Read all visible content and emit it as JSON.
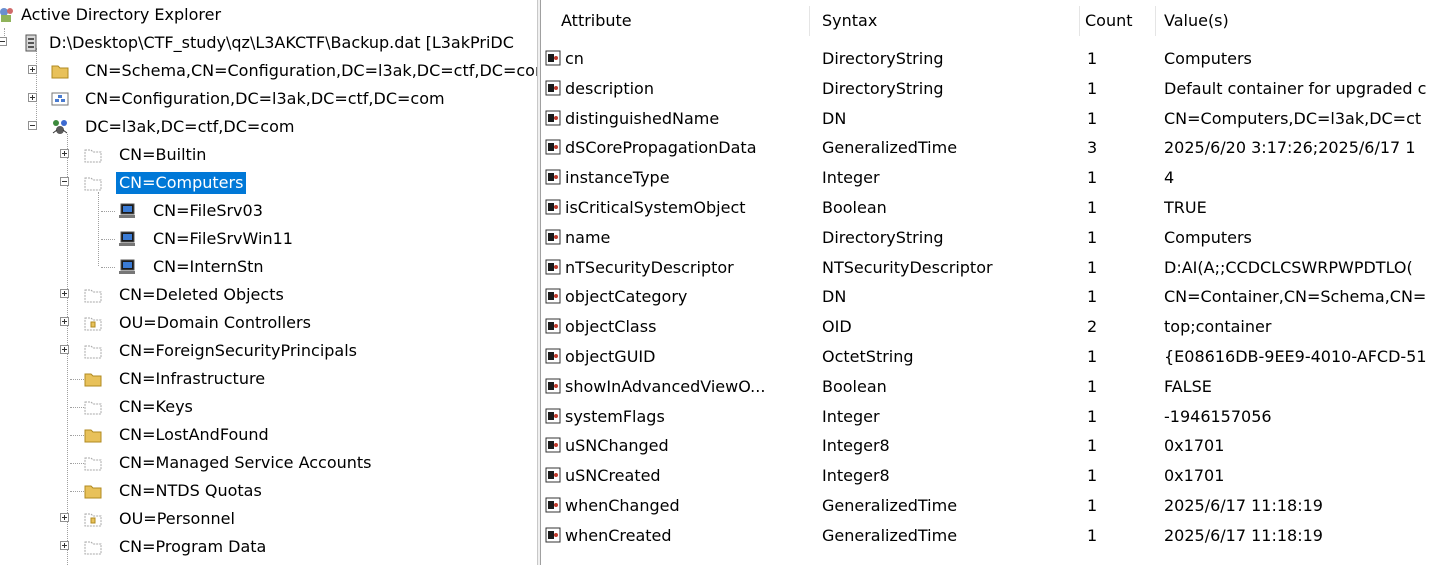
{
  "tree": {
    "root_label": "Active Directory Explorer",
    "snapshot_label": "D:\\Desktop\\CTF_study\\qz\\L3AKCTF\\Backup.dat [L3akPriDC",
    "nodes": [
      {
        "label": "CN=Schema,CN=Configuration,DC=l3ak,DC=ctf,DC=com",
        "icon": "folder-icon"
      },
      {
        "label": "CN=Configuration,DC=l3ak,DC=ctf,DC=com",
        "icon": "configuration-icon"
      },
      {
        "label": "DC=l3ak,DC=ctf,DC=com",
        "icon": "domain-icon"
      },
      {
        "label": "CN=Builtin",
        "icon": "container-icon"
      },
      {
        "label": "CN=Computers",
        "icon": "container-icon"
      },
      {
        "label": "CN=FileSrv03",
        "icon": "computer-icon"
      },
      {
        "label": "CN=FileSrvWin11",
        "icon": "computer-icon"
      },
      {
        "label": "CN=InternStn",
        "icon": "computer-icon"
      },
      {
        "label": "CN=Deleted Objects",
        "icon": "container-icon"
      },
      {
        "label": "OU=Domain Controllers",
        "icon": "ou-icon"
      },
      {
        "label": "CN=ForeignSecurityPrincipals",
        "icon": "container-icon"
      },
      {
        "label": "CN=Infrastructure",
        "icon": "folder-icon"
      },
      {
        "label": "CN=Keys",
        "icon": "container-icon"
      },
      {
        "label": "CN=LostAndFound",
        "icon": "folder-icon"
      },
      {
        "label": "CN=Managed Service Accounts",
        "icon": "container-icon"
      },
      {
        "label": "CN=NTDS Quotas",
        "icon": "folder-icon"
      },
      {
        "label": "OU=Personnel",
        "icon": "ou-icon"
      },
      {
        "label": "CN=Program Data",
        "icon": "container-icon"
      }
    ]
  },
  "attributes": {
    "columns": [
      "Attribute",
      "Syntax",
      "Count",
      "Value(s)"
    ],
    "rows": [
      {
        "attribute": "cn",
        "syntax": "DirectoryString",
        "count": "1",
        "value": "Computers"
      },
      {
        "attribute": "description",
        "syntax": "DirectoryString",
        "count": "1",
        "value": "Default container for upgraded c"
      },
      {
        "attribute": "distinguishedName",
        "syntax": "DN",
        "count": "1",
        "value": "CN=Computers,DC=l3ak,DC=ct"
      },
      {
        "attribute": "dSCorePropagationData",
        "syntax": "GeneralizedTime",
        "count": "3",
        "value": "2025/6/20 3:17:26;2025/6/17 1"
      },
      {
        "attribute": "instanceType",
        "syntax": "Integer",
        "count": "1",
        "value": "4"
      },
      {
        "attribute": "isCriticalSystemObject",
        "syntax": "Boolean",
        "count": "1",
        "value": "TRUE"
      },
      {
        "attribute": "name",
        "syntax": "DirectoryString",
        "count": "1",
        "value": "Computers"
      },
      {
        "attribute": "nTSecurityDescriptor",
        "syntax": "NTSecurityDescriptor",
        "count": "1",
        "value": "D:AI(A;;CCDCLCSWRPWPDTLO("
      },
      {
        "attribute": "objectCategory",
        "syntax": "DN",
        "count": "1",
        "value": "CN=Container,CN=Schema,CN="
      },
      {
        "attribute": "objectClass",
        "syntax": "OID",
        "count": "2",
        "value": "top;container"
      },
      {
        "attribute": "objectGUID",
        "syntax": "OctetString",
        "count": "1",
        "value": "{E08616DB-9EE9-4010-AFCD-51"
      },
      {
        "attribute": "showInAdvancedViewO...",
        "syntax": "Boolean",
        "count": "1",
        "value": "FALSE"
      },
      {
        "attribute": "systemFlags",
        "syntax": "Integer",
        "count": "1",
        "value": "-1946157056"
      },
      {
        "attribute": "uSNChanged",
        "syntax": "Integer8",
        "count": "1",
        "value": "0x1701"
      },
      {
        "attribute": "uSNCreated",
        "syntax": "Integer8",
        "count": "1",
        "value": "0x1701"
      },
      {
        "attribute": "whenChanged",
        "syntax": "GeneralizedTime",
        "count": "1",
        "value": "2025/6/17 11:18:19"
      },
      {
        "attribute": "whenCreated",
        "syntax": "GeneralizedTime",
        "count": "1",
        "value": "2025/6/17 11:18:19"
      }
    ]
  },
  "colors": {
    "selection": "#0078d7",
    "folder": "#e8c15a",
    "window_bg": "#ffffff"
  }
}
